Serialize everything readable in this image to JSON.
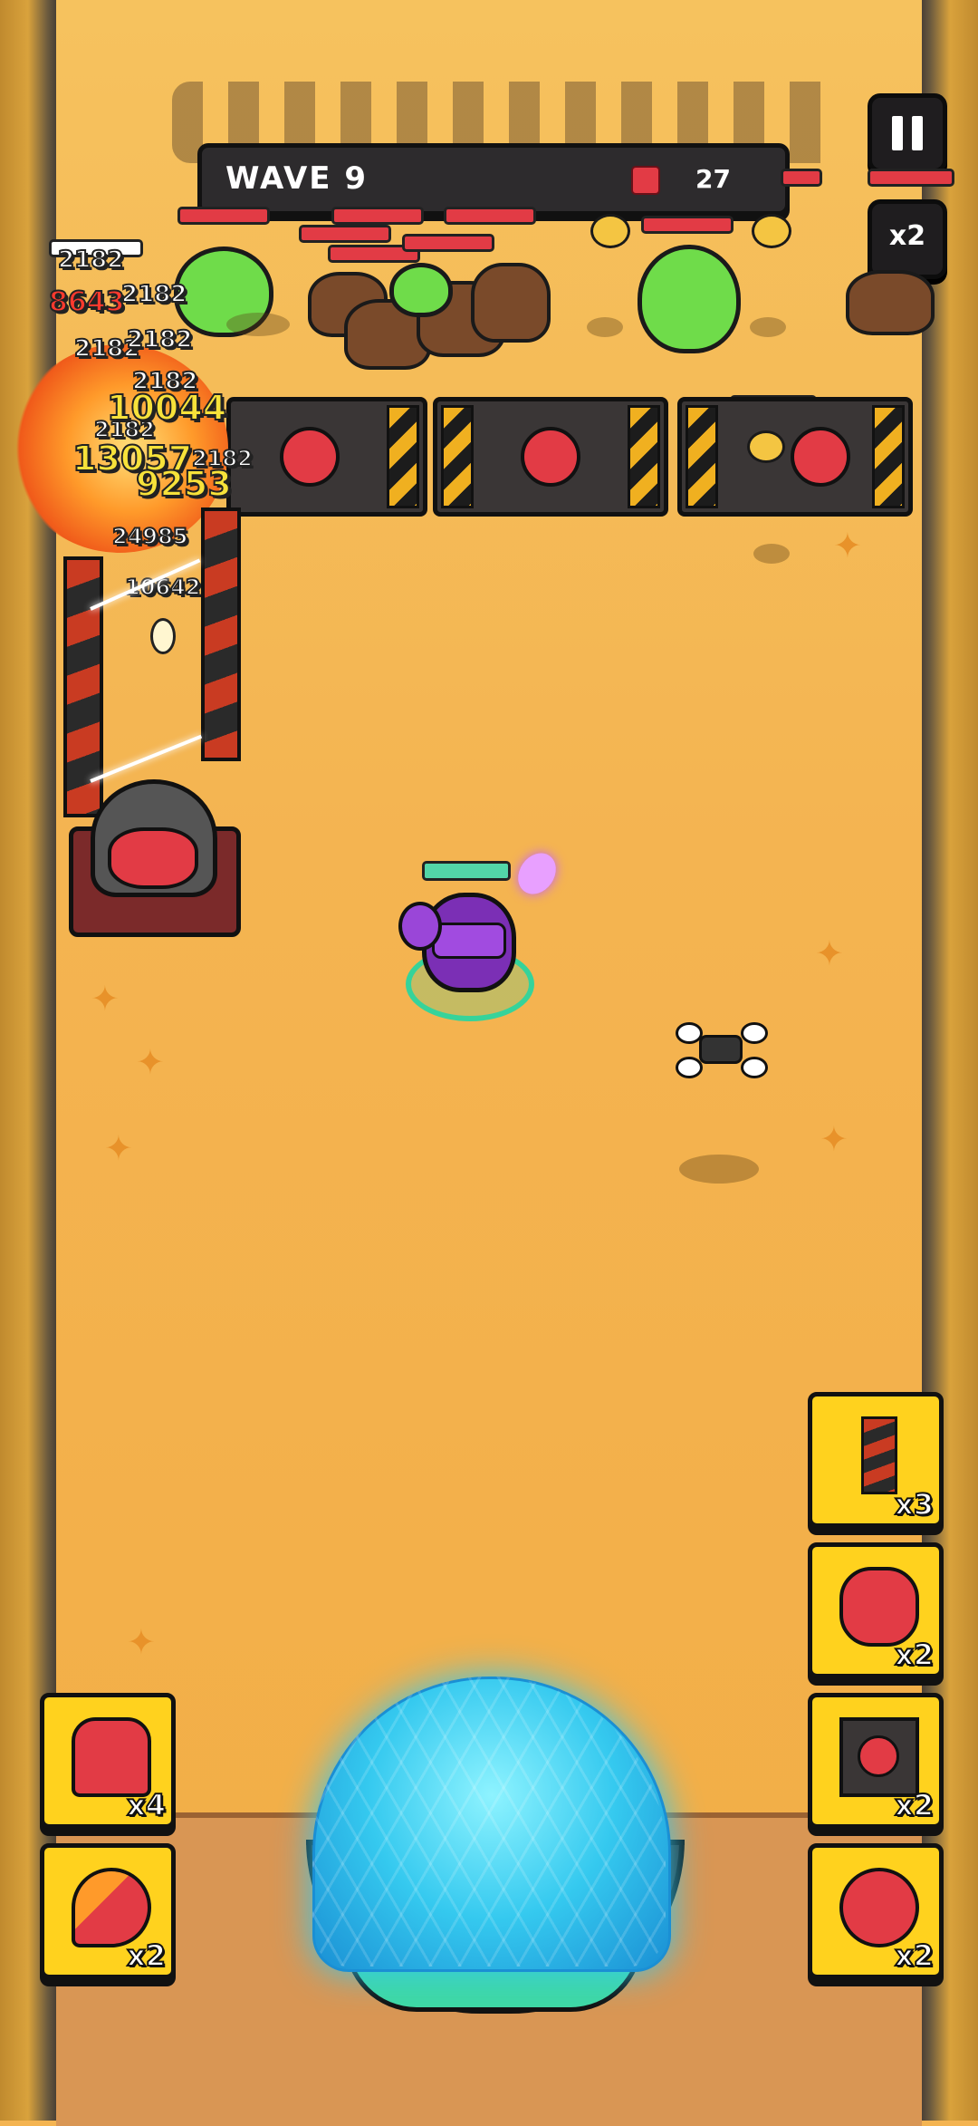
{
  "hud": {
    "wave_label": "WAVE 9",
    "enemy_icon": "enemy-pig-icon",
    "enemies_remaining": "27",
    "pause_icon": "pause-icon",
    "speed_label": "x2"
  },
  "damage_numbers": {
    "d1": "2182",
    "d2": "8643",
    "d3": "2182",
    "d4": "2182",
    "d5": "2182",
    "d6": "2182",
    "d7": "2182",
    "d8": "10044",
    "d9": "2182",
    "d10": "13057",
    "d11": "9253",
    "d12": "24985",
    "d13": "10642"
  },
  "abilities_right": [
    {
      "name": "barrier-pole-ability",
      "count": "x3"
    },
    {
      "name": "pig-turret-ability",
      "count": "x2"
    },
    {
      "name": "spike-mine-ability",
      "count": "x2"
    },
    {
      "name": "pig-bomb-ability",
      "count": "x2"
    }
  ],
  "abilities_left": [
    {
      "name": "pig-rider-ability",
      "count": "x4"
    },
    {
      "name": "pig-rocket-ability",
      "count": "x2"
    }
  ],
  "colors": {
    "field": "#f4b451",
    "hud_dark": "#2d2b2d",
    "health_red": "#e23b45",
    "card_yellow": "#ffd21e",
    "damage_yellow": "#f7e23a",
    "shield_cyan": "#35c9ef"
  }
}
